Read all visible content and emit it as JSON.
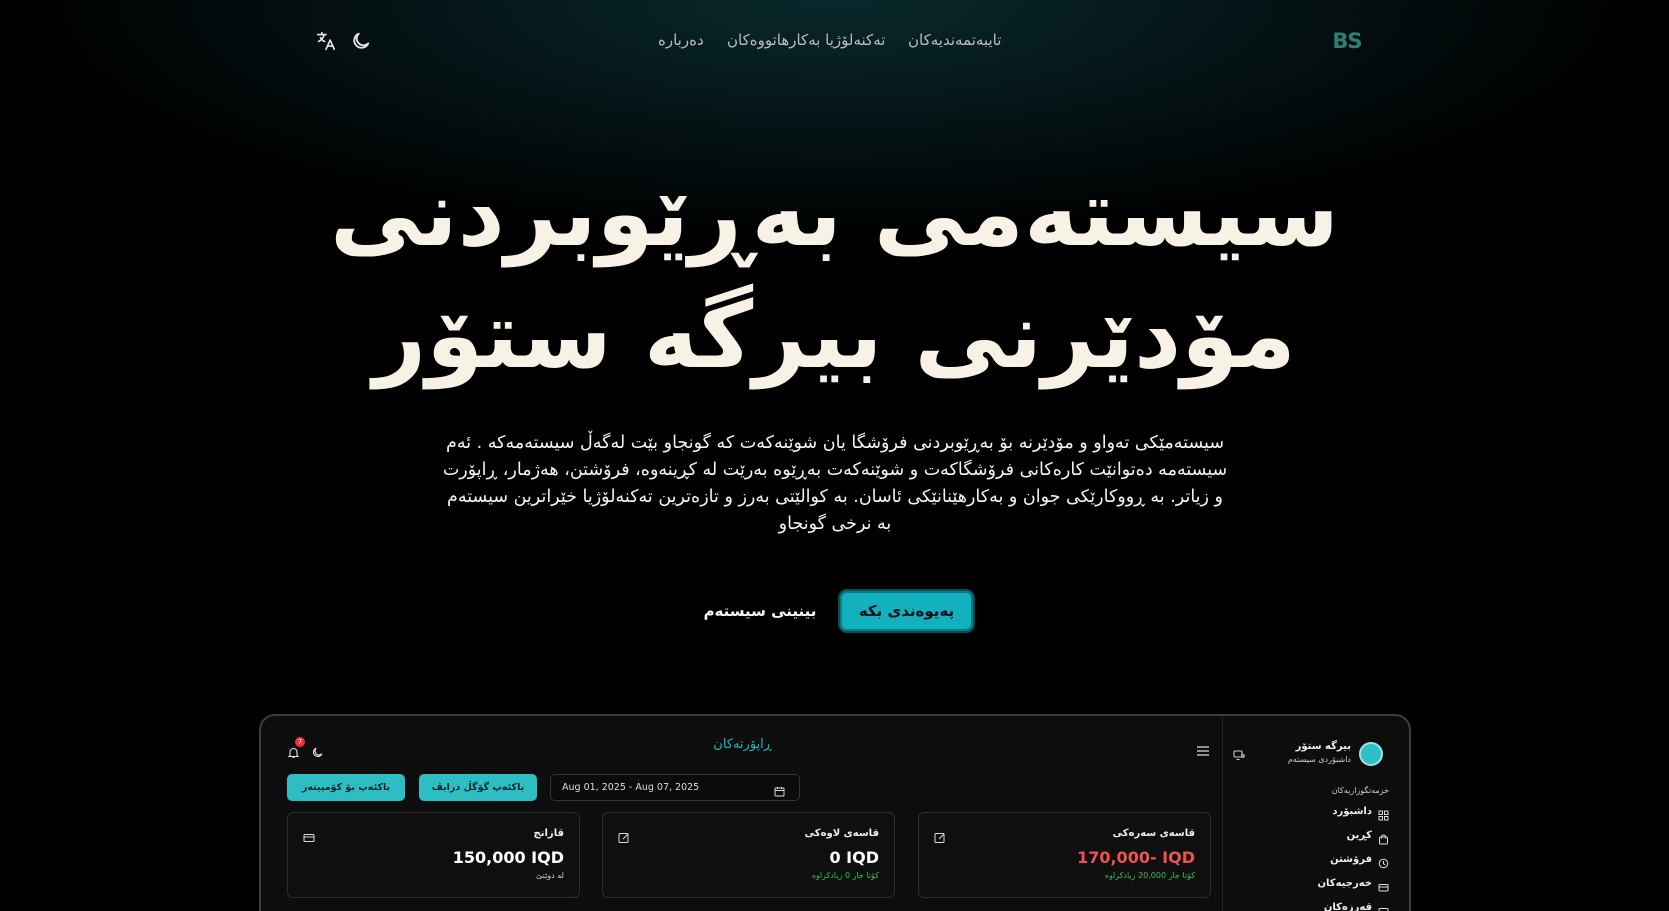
{
  "nav": {
    "logo": "BS",
    "links": [
      "تایبەتمەندیەکان",
      "تەکنەلۆژیا بەکارهاتووەکان",
      "دەربارە"
    ],
    "icons": [
      "translate-icon",
      "moon-icon"
    ]
  },
  "hero": {
    "title_line1": "سیستەمی بەڕێوبردنی",
    "title_line2": "مۆدێرنی بیرگە ستۆر",
    "subtitle": "سیستەمێکی تەواو و مۆدێرنە بۆ بەڕێوبردنی فرۆشگا یان شوێنەکەت کە گونجاو بێت لەگەڵ سیستەمەکە . ئەم سیستەمە دەتوانێت کارەکانی فرۆشگاکەت و شوێنەکەت بەڕێوە بەرێت لە کڕینەوە، فرۆشتن، هەژمار، ڕاپۆرت و زیاتر. بە ڕووکارێکی جوان و بەکارهێنانێکی ئاسان. بە کوالێتی بەرز و تازەترین تەکنەلۆژیا خێراترین سیستەم بە نرخی گونجاو",
    "primary_button": "پەیوەندی بکە",
    "secondary_button": "بینینی سیستەم"
  },
  "preview": {
    "title": "ڕاپۆرتەکان",
    "notification_count": "7",
    "btn_mobile": "باکئەپ گۆگڵ درایڤ",
    "btn_computer": "باکئەپ بۆ کۆمپیتەر",
    "date_range": "Aug 01, 2025 - Aug 07, 2025",
    "brand": {
      "name": "بیرگە ستۆر",
      "subtitle": "داشبۆردی سیستەم"
    },
    "sidebar": {
      "section_label": "خزمەتگوزاریەکان",
      "items": [
        {
          "label": "داشبۆرد",
          "icon": "grid-icon"
        },
        {
          "label": "کڕین",
          "icon": "bag-icon"
        },
        {
          "label": "فرۆشتن",
          "icon": "clock-icon"
        },
        {
          "label": "خەرجیەکان",
          "icon": "card-icon"
        },
        {
          "label": "قەرزەکان",
          "icon": "wallet-icon"
        }
      ]
    },
    "cards": [
      {
        "title": "قاسەی سەرەکی",
        "value": "170,000- IQD",
        "note": "کۆتا جار 20,000 زیادکراوە",
        "value_color": "#ef5350",
        "note_color": "#37c15a",
        "icon": "edit-icon"
      },
      {
        "title": "قاسەی لاوەکی",
        "value": "0 IQD",
        "note": "کۆتا جار 0 زیادکراوە",
        "value_color": "#ffffff",
        "note_color": "#37c15a",
        "icon": "edit-icon"
      },
      {
        "title": "قازانج",
        "value": "150,000 IQD",
        "note": "لە دوێنێ",
        "value_color": "#ffffff",
        "note_color": "#cfcfcf",
        "icon": "card-icon"
      }
    ]
  },
  "colors": {
    "accent": "#13b0bd",
    "background": "#000000",
    "logo": "#2e7e78"
  }
}
